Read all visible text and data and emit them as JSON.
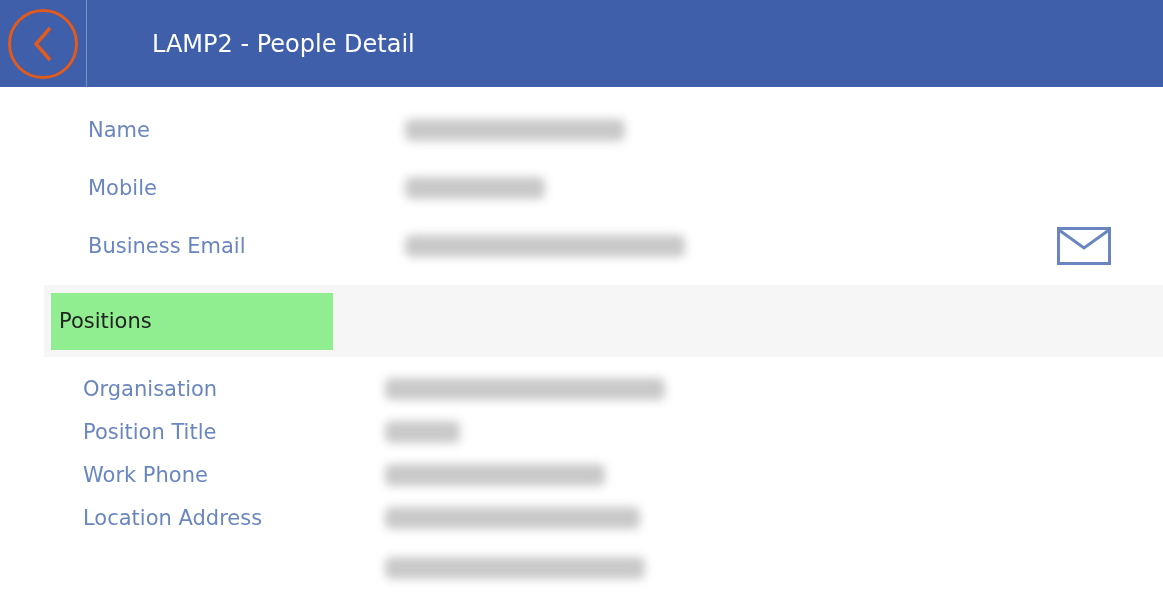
{
  "header": {
    "title": "LAMP2 - People Detail"
  },
  "contact": [
    {
      "label": "Name",
      "value": {
        "kind": "blurred"
      },
      "email_action": false
    },
    {
      "label": "Mobile",
      "value": {
        "kind": "blurred"
      },
      "email_action": false
    },
    {
      "label": "Business Email",
      "value": {
        "kind": "blurred"
      },
      "email_action": true
    }
  ],
  "positions": {
    "heading": "Positions",
    "rows": [
      {
        "label": "Organisation",
        "value": {
          "kind": "blurred"
        }
      },
      {
        "label": "Position Title",
        "value": {
          "kind": "blurred"
        }
      },
      {
        "label": "Work Phone",
        "value": {
          "kind": "blurred"
        }
      },
      {
        "label": "Location Address",
        "value": {
          "kind": "blurred"
        }
      },
      {
        "value": {
          "kind": "blurred"
        }
      }
    ]
  }
}
